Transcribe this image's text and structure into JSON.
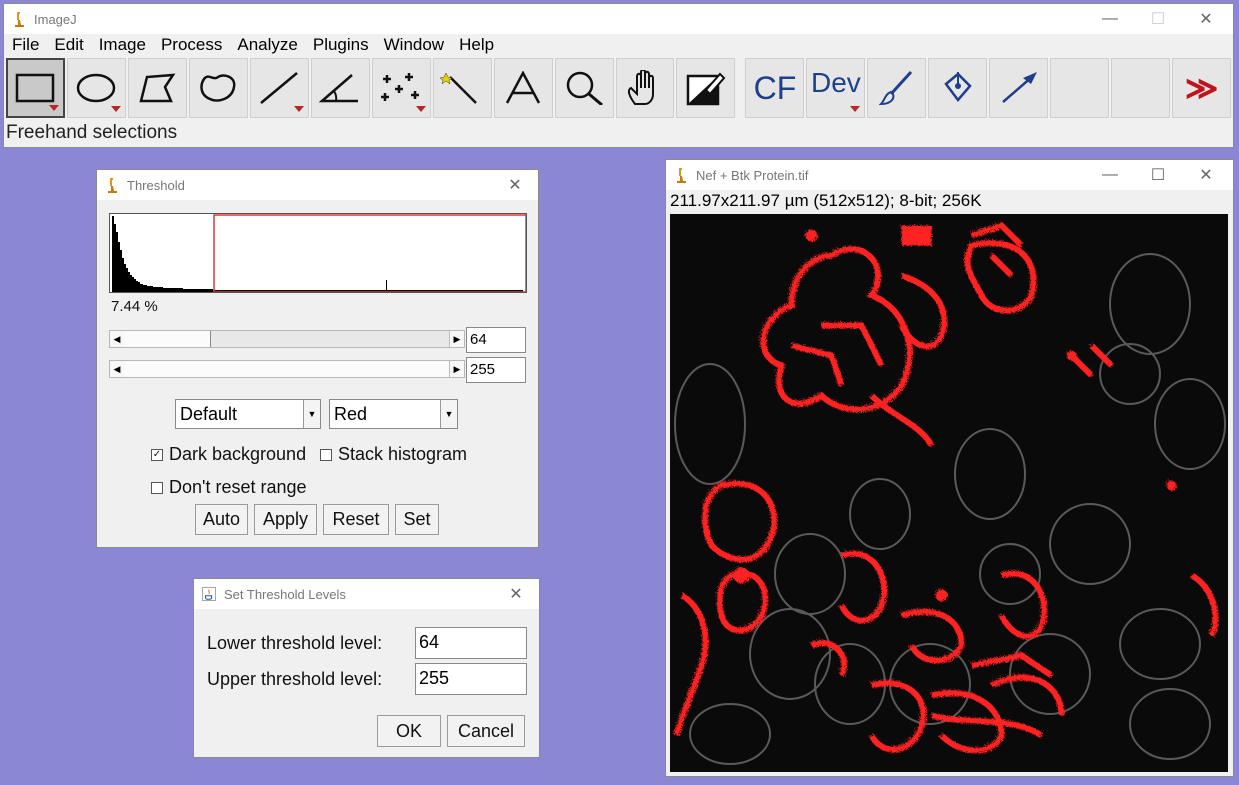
{
  "main": {
    "title": "ImageJ",
    "menu": [
      "File",
      "Edit",
      "Image",
      "Process",
      "Analyze",
      "Plugins",
      "Window",
      "Help"
    ],
    "tools": [
      "rectangle-tool",
      "oval-tool",
      "polygon-tool",
      "freehand-tool",
      "line-tool",
      "angle-tool",
      "multipoint-tool",
      "wand-tool",
      "text-tool",
      "magnifier-tool",
      "hand-tool",
      "color-picker-tool"
    ],
    "extra_tools": {
      "cf": "CF",
      "dev": "Dev",
      "more": "≫"
    },
    "status": "Freehand selections"
  },
  "threshold": {
    "title": "Threshold",
    "percent": "7.44 %",
    "lower": "64",
    "upper": "255",
    "method": "Default",
    "mode": "Red",
    "dark_background": "Dark background",
    "stack_histogram": "Stack histogram",
    "dont_reset": "Don't reset range",
    "buttons": {
      "auto": "Auto",
      "apply": "Apply",
      "reset": "Reset",
      "set": "Set"
    },
    "colors": {
      "threshold_box": "#e0363a"
    }
  },
  "set_levels": {
    "title": "Set Threshold Levels",
    "lower_label": "Lower threshold level:",
    "upper_label": "Upper threshold level:",
    "lower_value": "64",
    "upper_value": "255",
    "ok": "OK",
    "cancel": "Cancel"
  },
  "image": {
    "title": "Nef + Btk Protein.tif",
    "info": "211.97x211.97 µm (512x512); 8-bit; 256K",
    "colors": {
      "overlay": "#ff2020",
      "background": "#0a0a0a",
      "cells": "#9a9a9a"
    }
  }
}
